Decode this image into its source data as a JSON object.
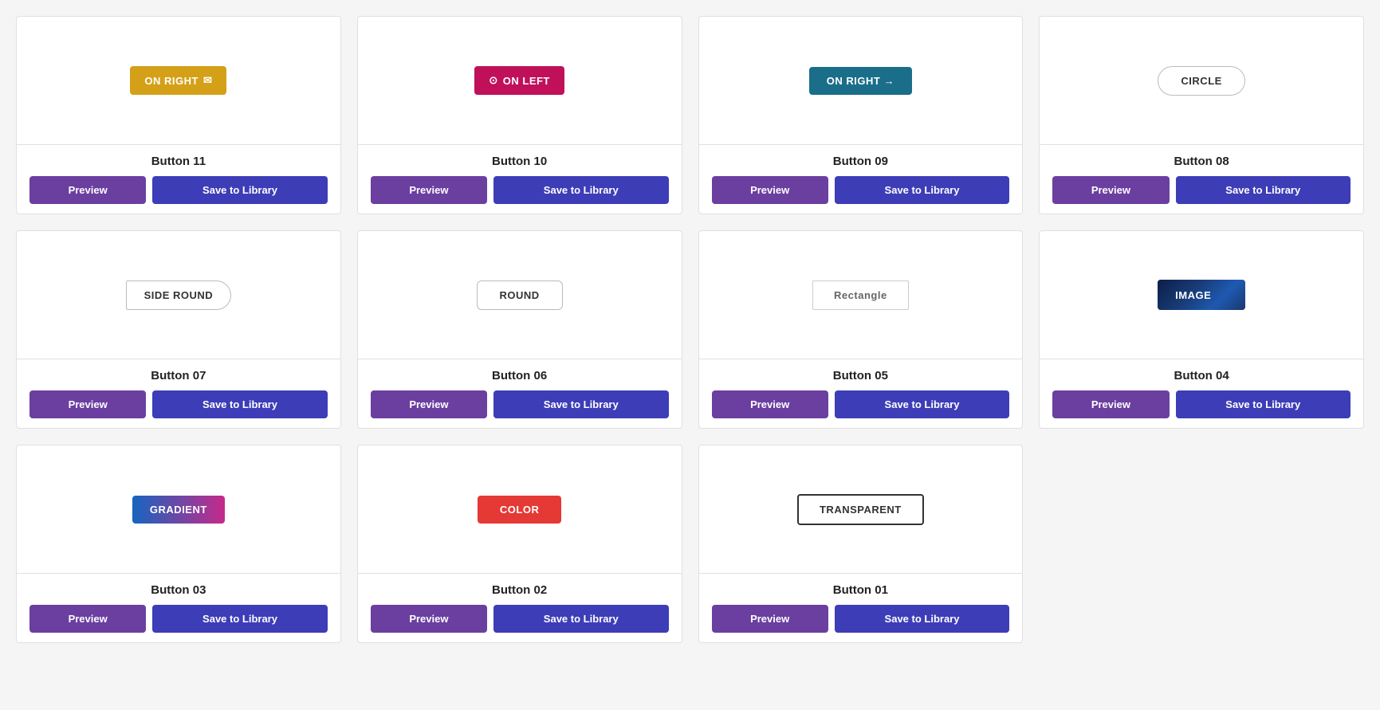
{
  "buttons": [
    {
      "id": "btn11",
      "name": "Button 11",
      "style": "on-right-icon",
      "label": "ON RIGHT",
      "icon": "✉",
      "preview_action": "Preview",
      "save_action": "Save to Library"
    },
    {
      "id": "btn10",
      "name": "Button 10",
      "style": "on-left-icon",
      "label": "ON LEFT",
      "icon": "⊙",
      "preview_action": "Preview",
      "save_action": "Save to Library"
    },
    {
      "id": "btn09",
      "name": "Button 09",
      "style": "on-right-arrow",
      "label": "ON RIGHT →",
      "preview_action": "Preview",
      "save_action": "Save to Library"
    },
    {
      "id": "btn08",
      "name": "Button 08",
      "style": "circle",
      "label": "CIRCLE",
      "preview_action": "Preview",
      "save_action": "Save to Library"
    },
    {
      "id": "btn07",
      "name": "Button 07",
      "style": "side-round",
      "label": "SIDE ROUND",
      "preview_action": "Preview",
      "save_action": "Save to Library"
    },
    {
      "id": "btn06",
      "name": "Button 06",
      "style": "round",
      "label": "ROUND",
      "preview_action": "Preview",
      "save_action": "Save to Library"
    },
    {
      "id": "btn05",
      "name": "Button 05",
      "style": "rectangle",
      "label": "Rectangle",
      "preview_action": "Preview",
      "save_action": "Save to Library"
    },
    {
      "id": "btn04",
      "name": "Button 04",
      "style": "image",
      "label": "IMAGE",
      "preview_action": "Preview",
      "save_action": "Save to Library"
    },
    {
      "id": "btn03",
      "name": "Button 03",
      "style": "gradient",
      "label": "GRADIENT",
      "preview_action": "Preview",
      "save_action": "Save to Library"
    },
    {
      "id": "btn02",
      "name": "Button 02",
      "style": "color",
      "label": "COLOR",
      "preview_action": "Preview",
      "save_action": "Save to Library"
    },
    {
      "id": "btn01",
      "name": "Button 01",
      "style": "transparent",
      "label": "TRANSPARENT",
      "preview_action": "Preview",
      "save_action": "Save to Library"
    }
  ]
}
